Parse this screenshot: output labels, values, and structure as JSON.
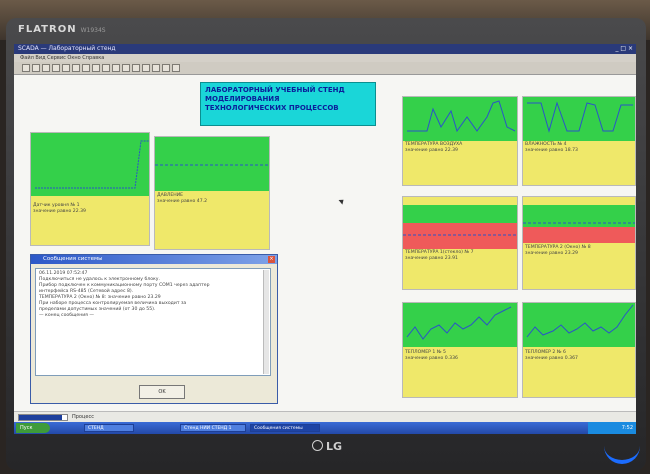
{
  "monitor": {
    "brand": "FLATRON",
    "model": "W1934S",
    "logo": "LG"
  },
  "app": {
    "window_title": "SCADA — Лабораторный стенд",
    "menu": "Файл  Вид  Сервис  Окно  Справка",
    "window_controls": "_ □ ×"
  },
  "stand_title": [
    "ЛАБОРАТОРНЫЙ УЧЕБНЫЙ СТЕНД",
    "МОДЕЛИРОВАНИЯ",
    "ТЕХНОЛОГИЧЕСКИХ ПРОЦЕССОВ"
  ],
  "panels": [
    {
      "id": "p1",
      "title": "Датчик уровня № 1",
      "value": "значение равно  22.39",
      "level": 0.55
    },
    {
      "id": "p2",
      "title": "ДАВЛЕНИЕ",
      "value": "значение равно  47.2",
      "level": 0.62
    },
    {
      "id": "p3",
      "title": "ТЕМПЕРАТУРА ВОЗДУХА",
      "value": "значение равно  22.39",
      "level": 0.48
    },
    {
      "id": "p4",
      "title": "ВЛАЖНОСТЬ № 4",
      "value": "значение равно  18.73",
      "level": 0.48
    },
    {
      "id": "p5",
      "title": "ТЕМПЕРАТУРА 1(стекло) № 7",
      "value": "значение равно  23.91",
      "level": 0.5
    },
    {
      "id": "p6",
      "title": "ТЕМПЕРАТУРА 2 (Окно) № 8",
      "value": "значение равно  23.29",
      "level": 0.5
    },
    {
      "id": "p7",
      "title": "ТЕПЛОМЕР 1 № 5",
      "value": "значение равно  0.336",
      "level": 0.45
    },
    {
      "id": "p8",
      "title": "ТЕПЛОМЕР 2 № 6",
      "value": "значение равно  0.367",
      "level": 0.45
    }
  ],
  "messages": {
    "title": "Сообщения системы",
    "close": "×",
    "lines": [
      "06.11.2019 07:52:47",
      "Подключиться не удалось к электронному блоку.",
      "Прибор подключен к коммуникационному порту СОМ1 через адаптер",
      "интерфейса RS-485 (Сетевой адрес 8).",
      "ТЕМПЕРАТУРА 2 (Окно) № 8:            значение равно 23.29",
      "При наборе процесса контролируемая величина выходит за",
      "пределами допустимых значений (от 30 до 55).",
      "— конец сообщения —"
    ],
    "ok": "OK"
  },
  "statusbar": {
    "text": "Процесс",
    "progress": 0.9
  },
  "taskbar": {
    "start": "Пуск",
    "tasks": [
      "СТЕНД",
      "Стенд НИИ СТЕНД 1",
      "Сообщения системы"
    ],
    "time": "7:52"
  },
  "colors": {
    "green": "#34d04a",
    "yellow": "#efe86a",
    "red": "#ef5a5a",
    "title_bg": "#1ad6d8",
    "title_text": "#0b1f9a"
  }
}
